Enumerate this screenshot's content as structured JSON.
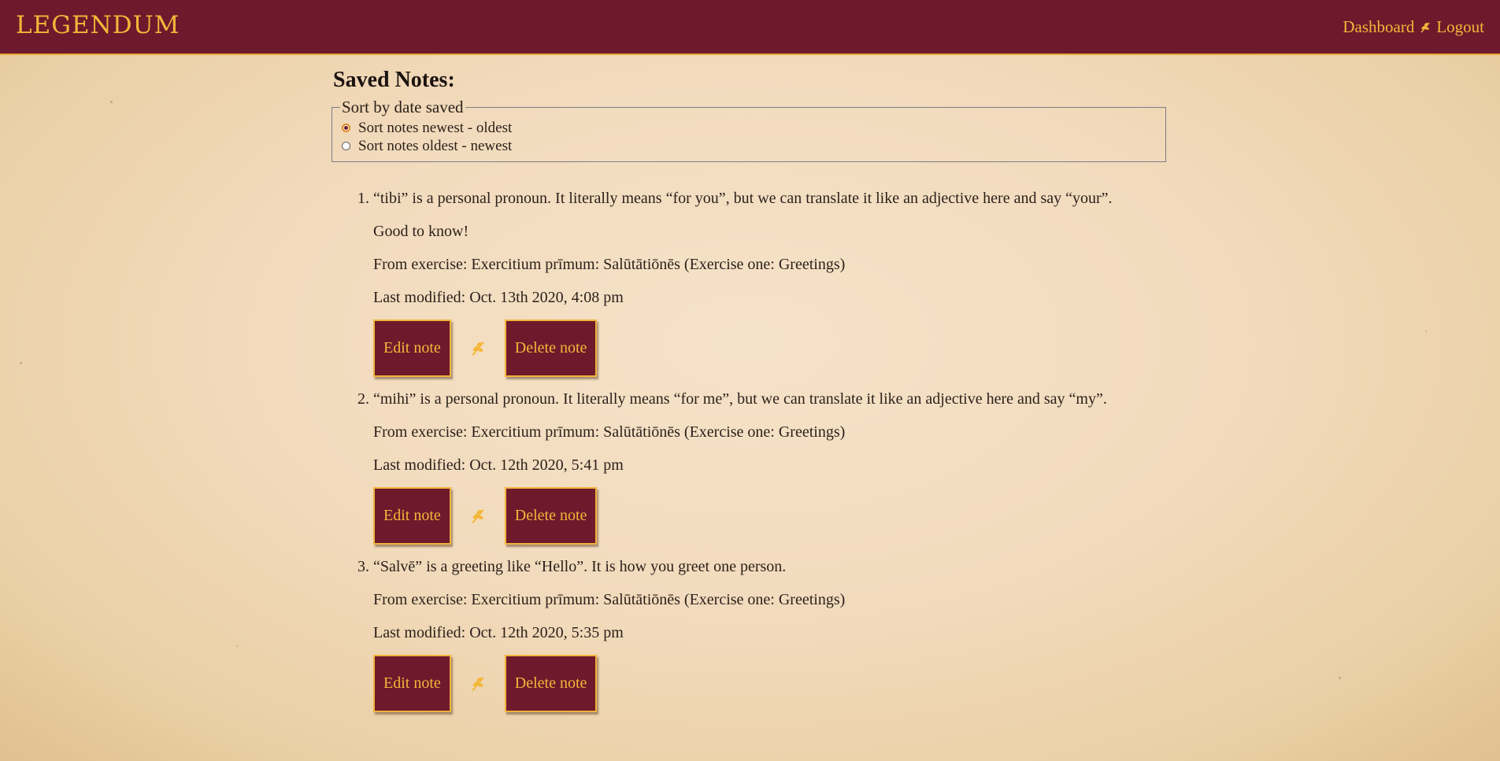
{
  "header": {
    "logo": "LEGENDUM",
    "nav": {
      "dashboard": "Dashboard",
      "logout": "Logout"
    }
  },
  "page": {
    "title": "Saved Notes:",
    "sort": {
      "legend": "Sort by date saved",
      "options": [
        {
          "label": "Sort notes newest - oldest",
          "checked": true
        },
        {
          "label": "Sort notes oldest - newest",
          "checked": false
        }
      ]
    }
  },
  "notes": [
    {
      "number": "1.",
      "text": "“tibi” is a personal pronoun. It literally means “for you”, but we can translate it like an adjective here and say “your”.",
      "extra": "Good to know!",
      "exercise": "From exercise: Exercitium prīmum: Salūtātiōnēs (Exercise one: Greetings)",
      "modified": "Last modified: Oct. 13th 2020, 4:08 pm",
      "edit_label": "Edit note",
      "delete_label": "Delete note"
    },
    {
      "number": "2.",
      "text": "“mihi” is a personal pronoun. It literally means “for me”, but we can translate it like an adjective here and say “my”.",
      "exercise": "From exercise: Exercitium prīmum: Salūtātiōnēs (Exercise one: Greetings)",
      "modified": "Last modified: Oct. 12th 2020, 5:41 pm",
      "edit_label": "Edit note",
      "delete_label": "Delete note"
    },
    {
      "number": "3.",
      "text": "“Salvē” is a greeting like “Hello”. It is how you greet one person.",
      "exercise": "From exercise: Exercitium prīmum: Salūtātiōnēs (Exercise one: Greetings)",
      "modified": "Last modified: Oct. 12th 2020, 5:35 pm",
      "edit_label": "Edit note",
      "delete_label": "Delete note"
    }
  ],
  "colors": {
    "brand": "#6e1a2c",
    "accent": "#f3b73a"
  },
  "icons": {
    "separator": "laurel-leaf-icon"
  }
}
